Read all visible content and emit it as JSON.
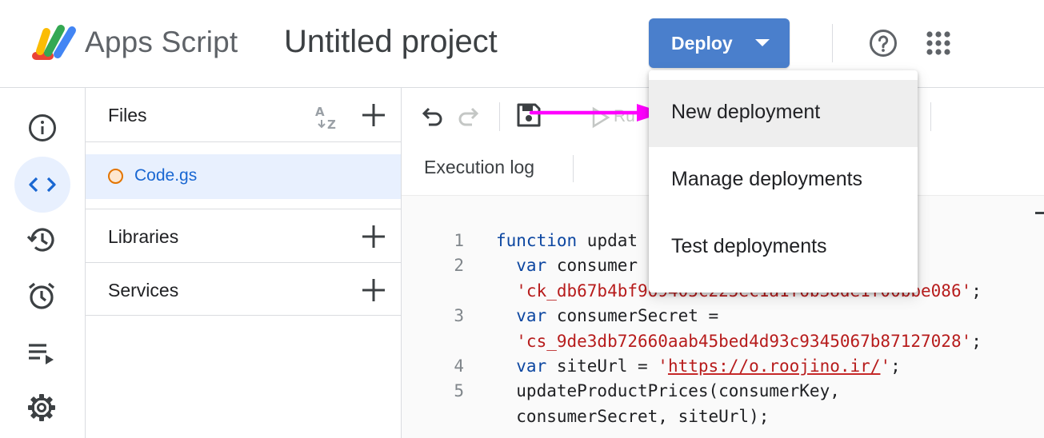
{
  "header": {
    "app_name": "Apps Script",
    "project_title": "Untitled project",
    "deploy_label": "Deploy",
    "icons": [
      "apps-script-logo",
      "help-icon",
      "apps-grid-icon",
      "caret-down-icon"
    ]
  },
  "rail": {
    "items": [
      {
        "name": "overview",
        "icon": "info-icon"
      },
      {
        "name": "editor",
        "icon": "code-icon",
        "active": true
      },
      {
        "name": "triggers-history",
        "icon": "history-icon"
      },
      {
        "name": "triggers",
        "icon": "alarm-icon"
      },
      {
        "name": "executions",
        "icon": "executions-icon"
      },
      {
        "name": "settings",
        "icon": "gear-icon"
      }
    ]
  },
  "files_panel": {
    "title": "Files",
    "files": [
      {
        "name": "Code.gs"
      }
    ],
    "libraries_label": "Libraries",
    "services_label": "Services"
  },
  "toolbar": {
    "run_label": "Ru",
    "execution_log_label": "Execution log"
  },
  "code": {
    "lines": [
      {
        "n": "1",
        "parts": [
          {
            "t": "function",
            "c": "kw"
          },
          {
            "t": " updat",
            "c": "id"
          }
        ]
      },
      {
        "n": "2",
        "parts": [
          {
            "t": "  var",
            "c": "kw"
          },
          {
            "t": " consumer",
            "c": "id"
          }
        ]
      },
      {
        "n": "",
        "parts": [
          {
            "t": "  'ck_db67b4bf969405c225ec1a1f6b38de1f00bbe086'",
            "c": "str"
          },
          {
            "t": ";",
            "c": "id"
          }
        ]
      },
      {
        "n": "3",
        "parts": [
          {
            "t": "  var",
            "c": "kw"
          },
          {
            "t": " consumerSecret =",
            "c": "id"
          }
        ]
      },
      {
        "n": "",
        "parts": [
          {
            "t": "  'cs_9de3db72660aab45bed4d93c9345067b87127028'",
            "c": "str"
          },
          {
            "t": ";",
            "c": "id"
          }
        ]
      },
      {
        "n": "4",
        "parts": [
          {
            "t": "  var",
            "c": "kw"
          },
          {
            "t": " siteUrl = ",
            "c": "id"
          },
          {
            "t": "'",
            "c": "str"
          },
          {
            "t": "https://o.roojino.ir/",
            "c": "url"
          },
          {
            "t": "'",
            "c": "str"
          },
          {
            "t": ";",
            "c": "id"
          }
        ]
      },
      {
        "n": "5",
        "parts": [
          {
            "t": "  updateProductPrices(consumerKey,",
            "c": "id"
          }
        ]
      },
      {
        "n": "",
        "parts": [
          {
            "t": "  consumerSecret, siteUrl);",
            "c": "id"
          }
        ]
      }
    ]
  },
  "deploy_menu": {
    "items": [
      {
        "label": "New deployment",
        "highlighted": true
      },
      {
        "label": "Manage deployments"
      },
      {
        "label": "Test deployments"
      }
    ]
  },
  "colors": {
    "deploy_button": "#4a7fcc",
    "active_file_bg": "#e8f0fe",
    "file_name": "#1967d2",
    "keyword": "#0d47a1",
    "string": "#b71c1c",
    "annotation_arrow": "#ff00ff"
  }
}
